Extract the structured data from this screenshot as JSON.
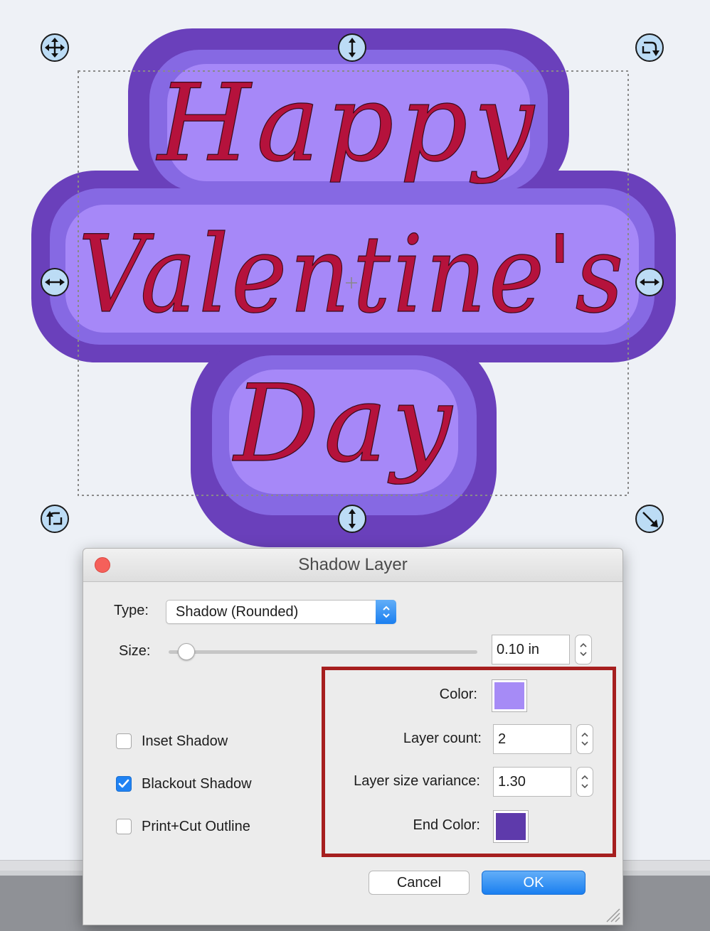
{
  "canvas": {
    "design_lines": [
      "Happy",
      "Valentine's",
      "Day"
    ],
    "colors": {
      "text_fill": "#b5123c",
      "shadow_inner": "#a688f8",
      "shadow_mid": "#8669e3",
      "shadow_outer": "#6a40bb",
      "selection_border": "#8a8a8a",
      "handle_fill": "#bcdcf5"
    },
    "handles": [
      "move-icon",
      "resize-vertical-icon",
      "rotate-icon",
      "resize-horizontal-icon",
      "resize-horizontal-icon",
      "rotate-icon",
      "resize-vertical-icon",
      "resize-diagonal-icon"
    ]
  },
  "dialog": {
    "title": "Shadow Layer",
    "type_label": "Type:",
    "type_value": "Shadow (Rounded)",
    "size_label": "Size:",
    "size_value": "0.10 in",
    "size_slider_fraction": 0.04,
    "color_label": "Color:",
    "color_value": "#a68bf6",
    "layer_count_label": "Layer count:",
    "layer_count_value": "2",
    "variance_label": "Layer size variance:",
    "variance_value": "1.30",
    "end_color_label": "End Color:",
    "end_color_value": "#5e3aab",
    "checkboxes": [
      {
        "label": "Inset Shadow",
        "checked": false
      },
      {
        "label": "Blackout Shadow",
        "checked": true
      },
      {
        "label": "Print+Cut Outline",
        "checked": false
      }
    ],
    "cancel_label": "Cancel",
    "ok_label": "OK",
    "highlight_color": "#a61f1f"
  }
}
